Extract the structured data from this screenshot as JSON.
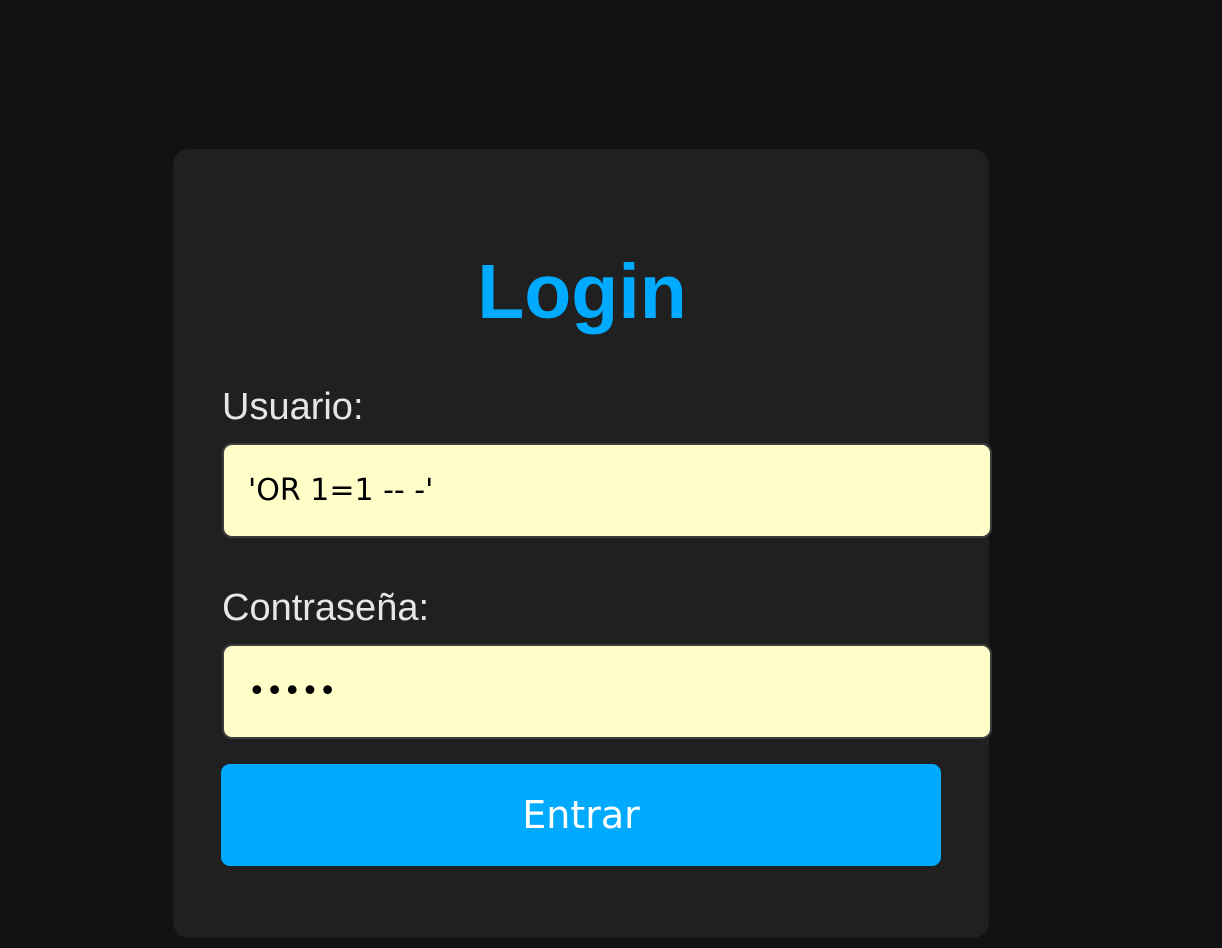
{
  "login": {
    "title": "Login",
    "username": {
      "label": "Usuario:",
      "value": "'OR 1=1 -- -'"
    },
    "password": {
      "label": "Contraseña:",
      "value": "•••••"
    },
    "submit_label": "Entrar"
  },
  "colors": {
    "page_background": "#121212",
    "card_background": "#202020",
    "accent": "#00aaff",
    "input_background": "#fffdc8",
    "label_text": "#e6e6e6"
  }
}
